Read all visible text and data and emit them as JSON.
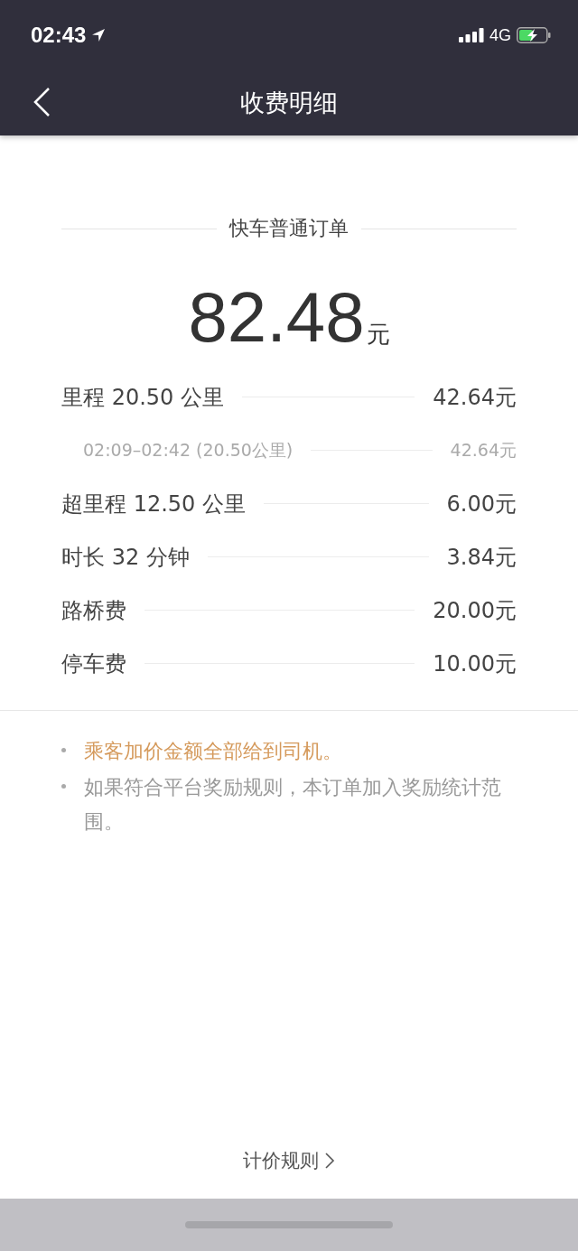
{
  "status_bar": {
    "time": "02:43",
    "network": "4G"
  },
  "nav": {
    "title": "收费明细"
  },
  "order": {
    "type": "快车普通订单",
    "amount": "82.48",
    "unit": "元"
  },
  "items": [
    {
      "kind": "main",
      "label": "里程 20.50 公里",
      "value": "42.64元"
    },
    {
      "kind": "sub",
      "label": "02:09–02:42 (20.50公里)",
      "value": "42.64元"
    },
    {
      "kind": "main",
      "label": "超里程 12.50 公里",
      "value": "6.00元"
    },
    {
      "kind": "main",
      "label": "时长 32 分钟",
      "value": "3.84元"
    },
    {
      "kind": "main",
      "label": "路桥费",
      "value": "20.00元"
    },
    {
      "kind": "main",
      "label": "停车费",
      "value": "10.00元"
    }
  ],
  "notes": [
    {
      "kind": "highlight",
      "text": "乘客加价金额全部给到司机。"
    },
    {
      "kind": "plain",
      "text": "如果符合平台奖励规则，本订单加入奖励统计范围。"
    }
  ],
  "footer_link": "计价规则"
}
